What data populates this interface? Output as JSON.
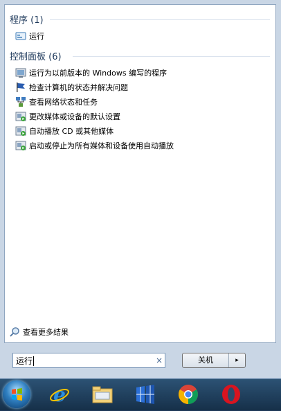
{
  "groups": [
    {
      "title": "程序 (1)",
      "items": [
        {
          "label": "运行",
          "icon": "run-icon"
        }
      ]
    },
    {
      "title": "控制面板 (6)",
      "items": [
        {
          "label": "运行为以前版本的 Windows 编写的程序",
          "icon": "compatibility-icon"
        },
        {
          "label": "检查计算机的状态并解决问题",
          "icon": "action-center-flag-icon"
        },
        {
          "label": "查看网络状态和任务",
          "icon": "network-icon"
        },
        {
          "label": "更改媒体或设备的默认设置",
          "icon": "autoplay-icon"
        },
        {
          "label": "自动播放 CD 或其他媒体",
          "icon": "autoplay-icon"
        },
        {
          "label": "启动或停止为所有媒体和设备使用自动播放",
          "icon": "autoplay-icon"
        }
      ]
    }
  ],
  "see_more": "查看更多结果",
  "search": {
    "value": "运行",
    "clear_glyph": "×"
  },
  "shutdown": {
    "label": "关机",
    "arrow_glyph": "▸"
  },
  "taskbar": {
    "pinned": [
      "internet-explorer-icon",
      "file-explorer-icon",
      "windows-store-icon",
      "chrome-icon",
      "opera-icon"
    ]
  }
}
